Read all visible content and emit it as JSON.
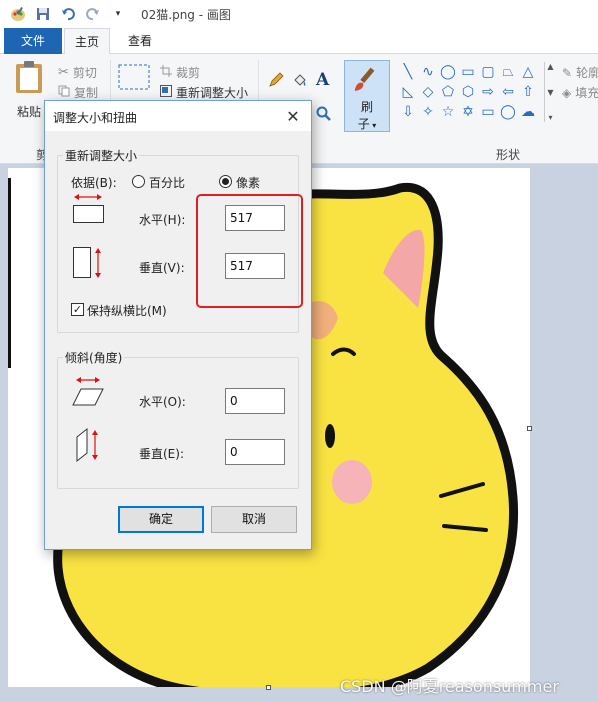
{
  "window": {
    "title": "02猫.png - 画图"
  },
  "tabs": {
    "file": "文件",
    "home": "主页",
    "view": "查看"
  },
  "ribbon": {
    "paste_label": "粘贴",
    "cut_label": "剪切",
    "copy_label": "复制",
    "crop_label": "裁剪",
    "resize_label": "重新调整大小",
    "brush_label": "刷",
    "brush_label2": "子",
    "outline_label": "轮廓",
    "fill_label": "填充",
    "clipboard_group_partial": "剪",
    "shapes_group": "形状"
  },
  "dialog": {
    "title": "调整大小和扭曲",
    "resize_section": "重新调整大小",
    "basis_label": "依据(B):",
    "percent_option": "百分比",
    "pixels_option": "像素",
    "selected_option": "pixels",
    "resize_horizontal_label": "水平(H):",
    "resize_horizontal_value": "517",
    "resize_vertical_label": "垂直(V):",
    "resize_vertical_value": "517",
    "keep_ratio_label": "保持纵横比(M)",
    "keep_ratio_checked": true,
    "skew_section": "倾斜(角度)",
    "skew_horizontal_label": "水平(O):",
    "skew_horizontal_value": "0",
    "skew_vertical_label": "垂直(E):",
    "skew_vertical_value": "0",
    "ok_label": "确定",
    "cancel_label": "取消"
  },
  "watermark": "CSDN @阿夏reasonsummer",
  "colors": {
    "accent": "#1e65b4",
    "highlight": "#e02020",
    "cat_yellow": "#f9e342",
    "cat_ear": "#f3a7a6",
    "cat_patch": "#f2b07c",
    "cheek": "#f6b3b8"
  }
}
